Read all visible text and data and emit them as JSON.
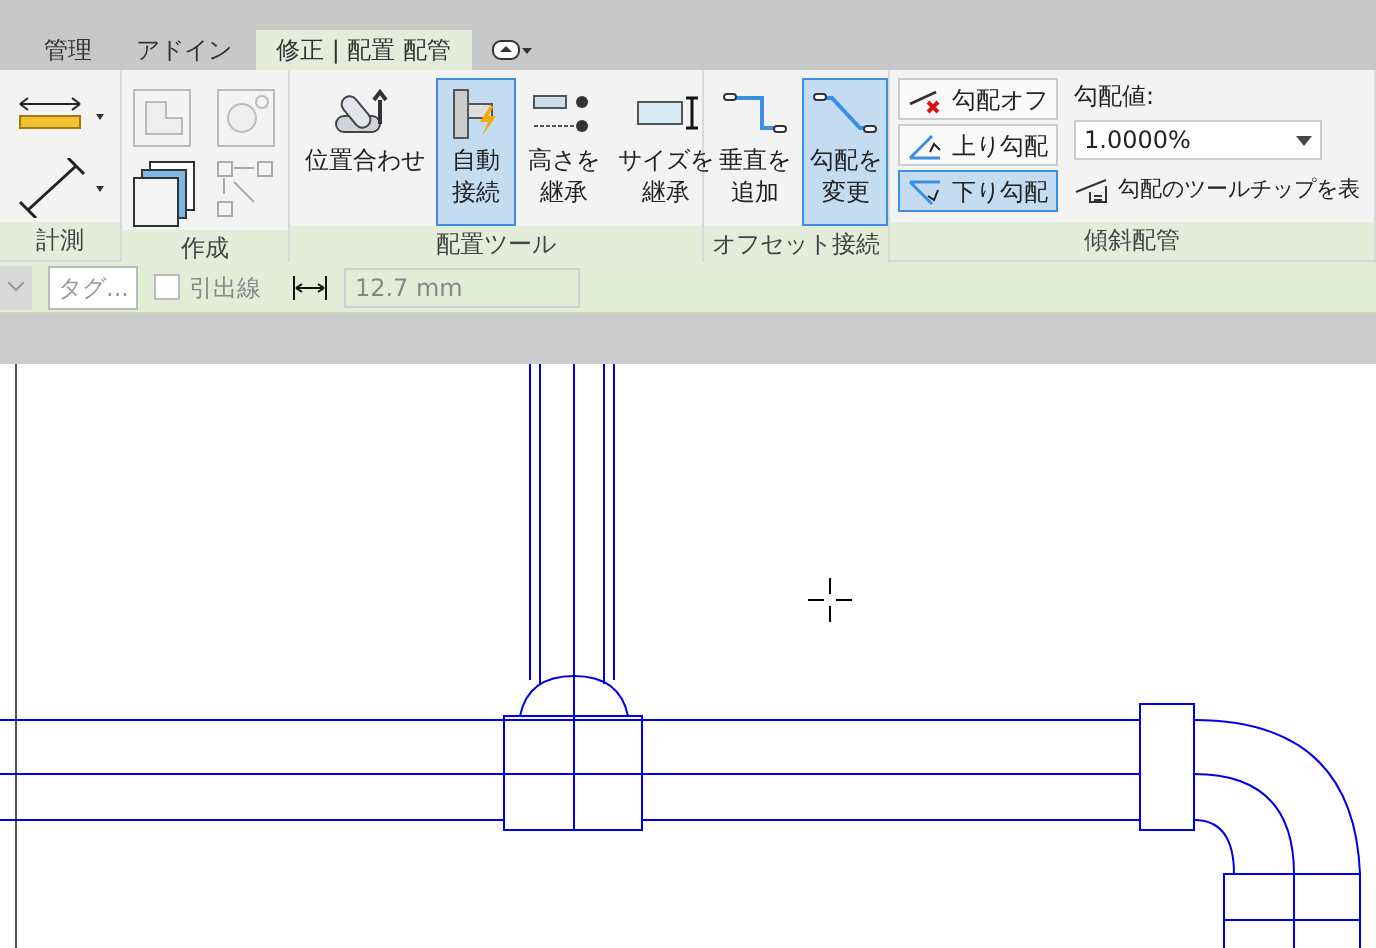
{
  "tabs": [
    {
      "label": "管理",
      "selected": false
    },
    {
      "label": "アドイン",
      "selected": false
    },
    {
      "label": "修正 | 配置 配管",
      "selected": true
    }
  ],
  "ribbon": {
    "groups": [
      {
        "kind": "measure",
        "label": "計測"
      },
      {
        "kind": "create",
        "label": "作成"
      },
      {
        "kind": "tools",
        "label": "配置ツール",
        "buttons": [
          {
            "label": "位置合わせ",
            "selected": false
          },
          {
            "label": "自動接続",
            "selected": true
          },
          {
            "label": "高さを継承",
            "selected": false
          },
          {
            "label": "サイズを継承",
            "selected": false
          }
        ]
      },
      {
        "kind": "offset",
        "label": "オフセット接続",
        "buttons": [
          {
            "label": "垂直を追加",
            "selected": false
          },
          {
            "label": "勾配を変更",
            "selected": true
          }
        ]
      },
      {
        "kind": "slope",
        "label": "傾斜配管",
        "buttons": [
          {
            "label": "勾配オフ",
            "selected": false
          },
          {
            "label": "上り勾配",
            "selected": false
          },
          {
            "label": "下り勾配",
            "selected": true
          }
        ],
        "value_label": "勾配値:",
        "value": "1.0000%",
        "tooltip_label": "勾配のツールチップを表"
      }
    ]
  },
  "options_bar": {
    "tag_button": "タグ...",
    "leader": {
      "label": "引出線",
      "checked": false
    },
    "offset_value": "12.7 mm"
  }
}
